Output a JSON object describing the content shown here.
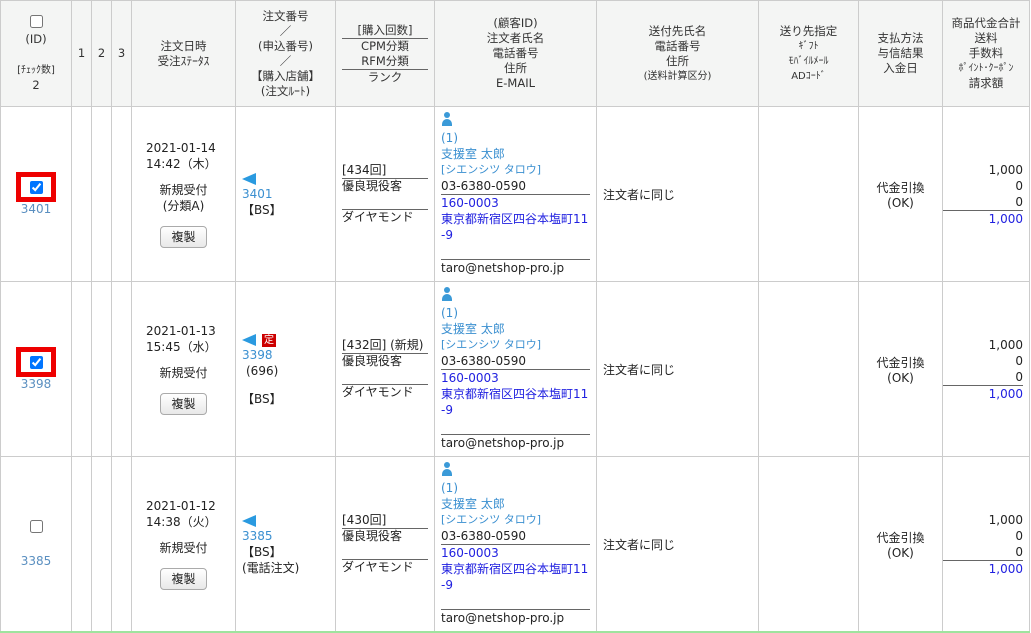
{
  "header": {
    "id_col": {
      "label": "(ID)",
      "check_count_label": "[ﾁｪｯｸ数]",
      "check_count": "2"
    },
    "num_cols": [
      "1",
      "2",
      "3"
    ],
    "date_col": [
      "注文日時",
      "受注ｽﾃｰﾀｽ"
    ],
    "order_col": [
      "注文番号",
      "／",
      "(申込番号)",
      "／",
      "【購入店舗】",
      "(注文ﾙｰﾄ)"
    ],
    "rank_col": [
      "[購入回数]",
      "CPM分類",
      "RFM分類",
      "ランク"
    ],
    "customer_col": [
      "(顧客ID)",
      "注文者氏名",
      "電話番号",
      "住所",
      "E-MAIL"
    ],
    "ship_col": [
      "送付先氏名",
      "電話番号",
      "住所",
      "(送料計算区分)"
    ],
    "dest_col": [
      "送り先指定",
      "ｷﾞﾌﾄ",
      "ﾓﾊﾞｲﾙﾒｰﾙ",
      "ADｺｰﾄﾞ"
    ],
    "pay_col": [
      "支払方法",
      "与信結果",
      "入金日"
    ],
    "amount_col": [
      "商品代金合計",
      "送料",
      "手数料",
      "ﾎﾟｲﾝﾄ･ｸｰﾎﾟﾝ",
      "請求額"
    ]
  },
  "rows": [
    {
      "checked": true,
      "id": "3401",
      "date": "2021-01-14",
      "time": "14:42（木）",
      "status": "新規受付",
      "status_sub": "(分類A)",
      "copy_label": "複製",
      "order_no": "3401",
      "teiki": "",
      "app_no": "",
      "store": "【BS】",
      "route": "",
      "purchase_count": "[434回]",
      "cpm": "優良現役客",
      "rfm": "",
      "rank": "ダイヤモンド",
      "cust_id": "(1)",
      "name": "支援室 太郎",
      "kana": "[シエンシツ タロウ]",
      "phone": "03-6380-0590",
      "zip": "160-0003",
      "address": "東京都新宿区四谷本塩町11-9",
      "email": "taro@netshop-pro.jp",
      "ship_to": "注文者に同じ",
      "pay_method": "代金引換",
      "credit": "(OK)",
      "subtotal": "1,000",
      "shipping": "0",
      "fee": "0",
      "total": "1,000"
    },
    {
      "checked": true,
      "id": "3398",
      "date": "2021-01-13",
      "time": "15:45（水）",
      "status": "新規受付",
      "status_sub": "",
      "copy_label": "複製",
      "order_no": "3398",
      "teiki": "定",
      "app_no": "(696)",
      "store": "【BS】",
      "route": "",
      "purchase_count": "[432回] (新規)",
      "cpm": "優良現役客",
      "rfm": "",
      "rank": "ダイヤモンド",
      "cust_id": "(1)",
      "name": "支援室 太郎",
      "kana": "[シエンシツ タロウ]",
      "phone": "03-6380-0590",
      "zip": "160-0003",
      "address": "東京都新宿区四谷本塩町11-9",
      "email": "taro@netshop-pro.jp",
      "ship_to": "注文者に同じ",
      "pay_method": "代金引換",
      "credit": "(OK)",
      "subtotal": "1,000",
      "shipping": "0",
      "fee": "0",
      "total": "1,000"
    },
    {
      "checked": false,
      "id": "3385",
      "date": "2021-01-12",
      "time": "14:38（火）",
      "status": "新規受付",
      "status_sub": "",
      "copy_label": "複製",
      "order_no": "3385",
      "teiki": "",
      "app_no": "",
      "store": "【BS】",
      "route": "(電話注文)",
      "purchase_count": "[430回]",
      "cpm": "優良現役客",
      "rfm": "",
      "rank": "ダイヤモンド",
      "cust_id": "(1)",
      "name": "支援室 太郎",
      "kana": "[シエンシツ タロウ]",
      "phone": "03-6380-0590",
      "zip": "160-0003",
      "address": "東京都新宿区四谷本塩町11-9",
      "email": "taro@netshop-pro.jp",
      "ship_to": "注文者に同じ",
      "pay_method": "代金引換",
      "credit": "(OK)",
      "subtotal": "1,000",
      "shipping": "0",
      "fee": "0",
      "total": "1,000"
    }
  ]
}
